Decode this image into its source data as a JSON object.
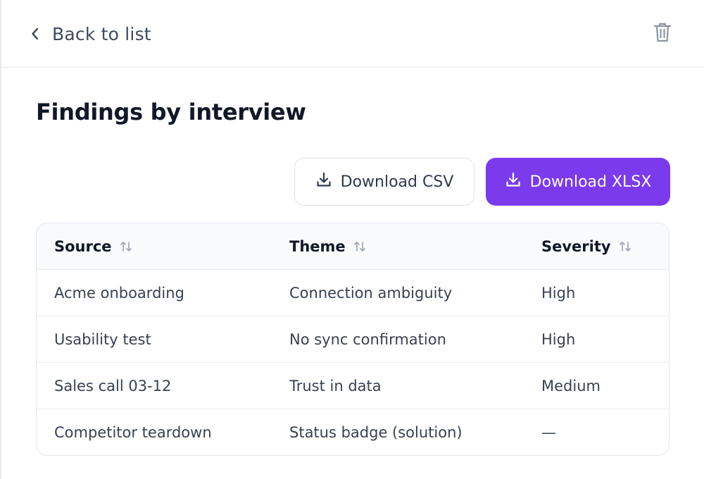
{
  "header": {
    "back_label": "Back to list"
  },
  "page": {
    "title": "Findings by interview"
  },
  "actions": {
    "download_csv_label": "Download CSV",
    "download_xlsx_label": "Download XLSX"
  },
  "table": {
    "columns": [
      {
        "label": "Source"
      },
      {
        "label": "Theme"
      },
      {
        "label": "Severity"
      }
    ],
    "rows": [
      {
        "source": "Acme onboarding",
        "theme": "Connection ambiguity",
        "severity": "High"
      },
      {
        "source": "Usability test",
        "theme": "No sync confirmation",
        "severity": "High"
      },
      {
        "source": "Sales call 03-12",
        "theme": "Trust in data",
        "severity": "Medium"
      },
      {
        "source": "Competitor teardown",
        "theme": "Status badge (solution)",
        "severity": "—"
      }
    ]
  },
  "icons": {
    "back": "chevron-left-icon",
    "delete": "trash-icon",
    "download": "download-icon",
    "sort": "sort-icon"
  },
  "colors": {
    "accent": "#7c3aed",
    "text_primary": "#111827",
    "text_secondary": "#374151",
    "border": "#e3e6ee",
    "header_bg": "#f8fafc"
  }
}
